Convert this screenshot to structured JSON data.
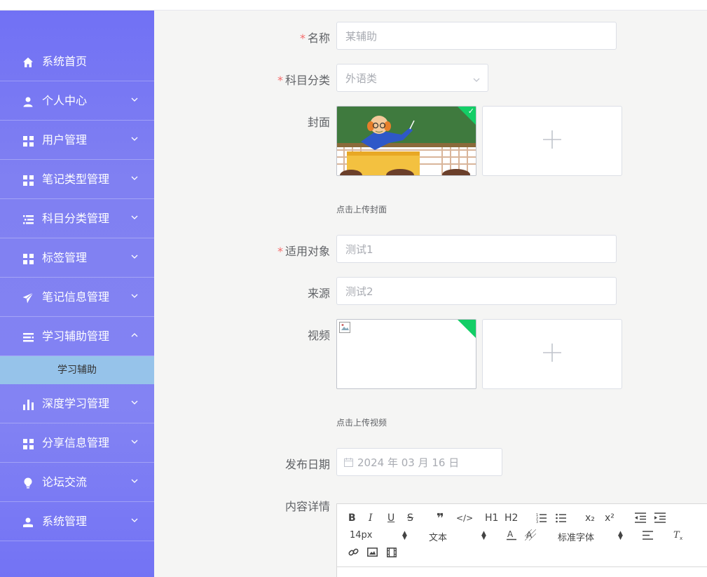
{
  "sidebar": {
    "items": [
      {
        "label": "系统首页",
        "icon": "home-icon",
        "arrow": "none"
      },
      {
        "label": "个人中心",
        "icon": "user-icon",
        "arrow": "down"
      },
      {
        "label": "用户管理",
        "icon": "grid-icon",
        "arrow": "down"
      },
      {
        "label": "笔记类型管理",
        "icon": "grid-icon",
        "arrow": "down"
      },
      {
        "label": "科目分类管理",
        "icon": "list-icon",
        "arrow": "down"
      },
      {
        "label": "标签管理",
        "icon": "grid-icon",
        "arrow": "down"
      },
      {
        "label": "笔记信息管理",
        "icon": "send-icon",
        "arrow": "down"
      },
      {
        "label": "学习辅助管理",
        "icon": "menu-icon",
        "arrow": "up"
      }
    ],
    "submenu": {
      "label": "学习辅助"
    },
    "items_after": [
      {
        "label": "深度学习管理",
        "icon": "bar-chart-icon",
        "arrow": "down"
      },
      {
        "label": "分享信息管理",
        "icon": "grid-icon",
        "arrow": "down"
      },
      {
        "label": "论坛交流",
        "icon": "bulb-icon",
        "arrow": "down"
      },
      {
        "label": "系统管理",
        "icon": "admin-icon",
        "arrow": "down"
      }
    ]
  },
  "form": {
    "required_mark": "*",
    "name": {
      "label": "名称",
      "placeholder": "某辅助"
    },
    "category": {
      "label": "科目分类",
      "placeholder": "外语类"
    },
    "cover": {
      "label": "封面",
      "tip": "点击上传封面"
    },
    "audience": {
      "label": "适用对象",
      "placeholder": "测试1"
    },
    "source": {
      "label": "来源",
      "placeholder": "测试2"
    },
    "video": {
      "label": "视频",
      "tip": "点击上传视频"
    },
    "publish_date": {
      "label": "发布日期",
      "value": "2024 年 03 月 16 日"
    },
    "content": {
      "label": "内容详情"
    }
  },
  "editor": {
    "font_size": "14px",
    "heading": "文本",
    "font_family": "标准字体",
    "buttons": {
      "bold": "B",
      "italic": "I",
      "underline": "U",
      "strike": "S",
      "h1": "H1",
      "h2": "H2",
      "sub": "x₂",
      "sup": "x²"
    }
  },
  "colors": {
    "accent": "#7373f4",
    "active_submenu": "#96c3ea",
    "success": "#13ce66",
    "required": "#f56c6c"
  }
}
